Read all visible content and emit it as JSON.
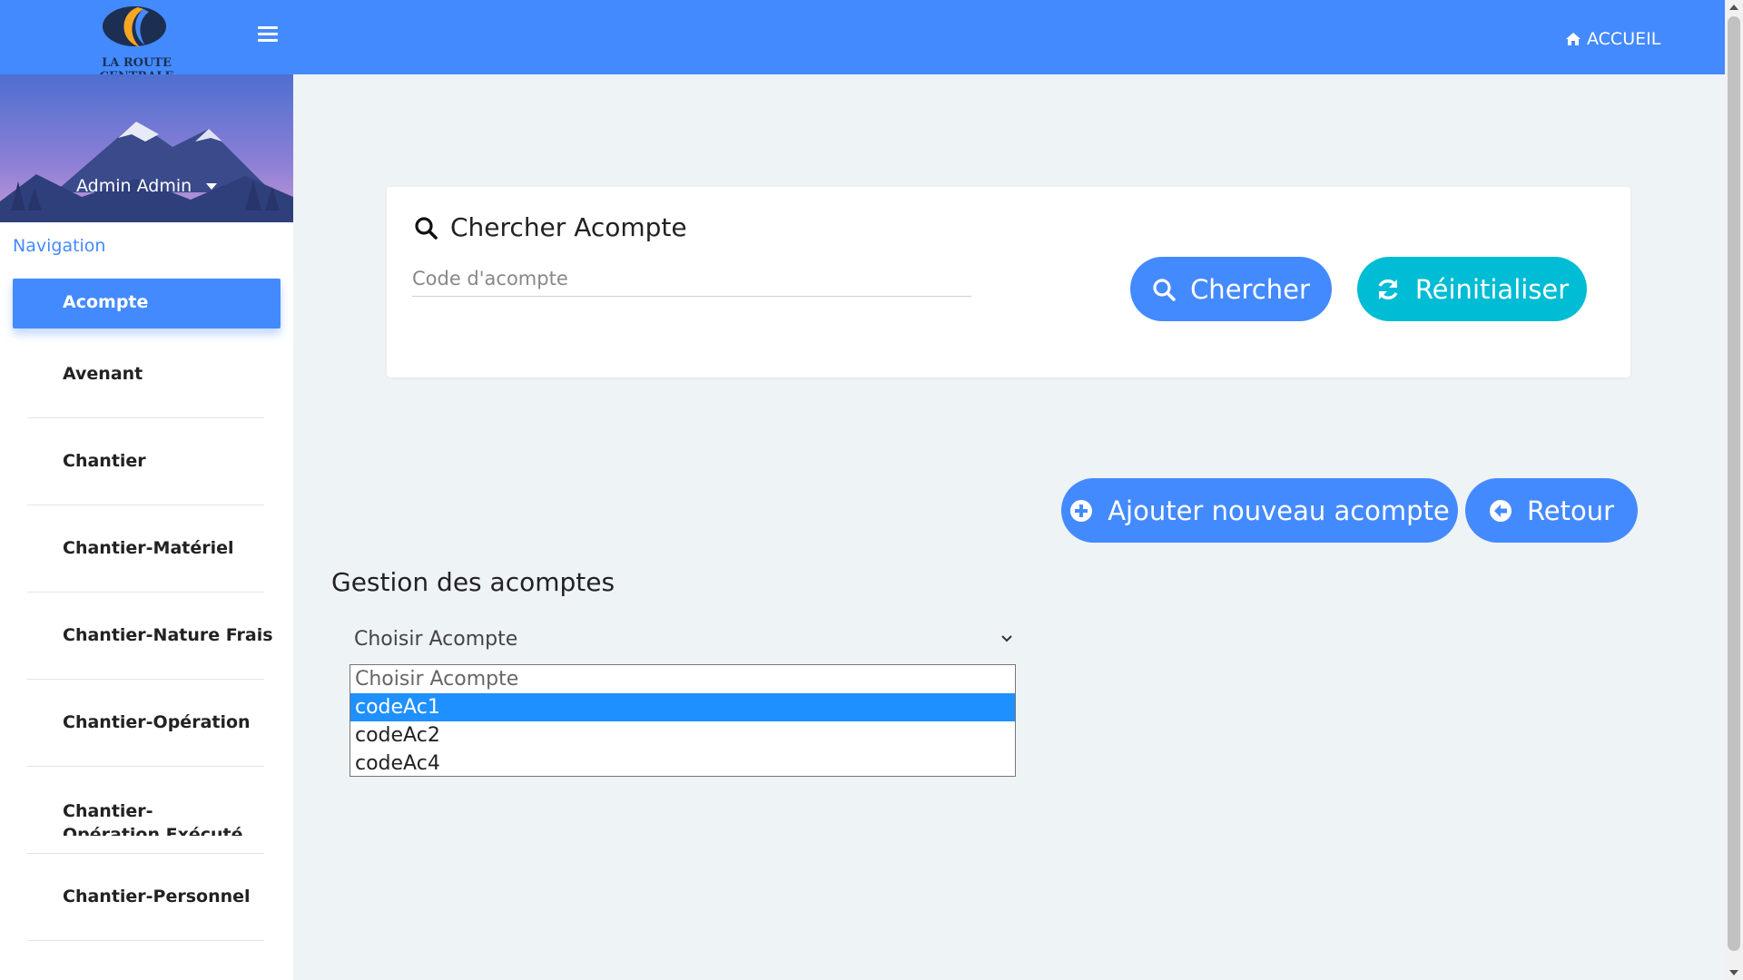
{
  "header": {
    "logo_text": "LA ROUTE CENTRALE",
    "home_link": "ACCUEIL",
    "bar_color": "#448aff"
  },
  "sidebar": {
    "user_name": "Admin Admin",
    "nav_title": "Navigation",
    "items": [
      {
        "label": "Acompte",
        "active": true
      },
      {
        "label": "Avenant"
      },
      {
        "label": "Chantier"
      },
      {
        "label": "Chantier-Matériel"
      },
      {
        "label": "Chantier-Nature Frais"
      },
      {
        "label": "Chantier-Opération"
      },
      {
        "label": "Chantier-Opération Exécuté"
      },
      {
        "label": "Chantier-Personnel"
      }
    ]
  },
  "search": {
    "title": "Chercher Acompte",
    "placeholder": "Code d'acompte",
    "value": "",
    "search_button": "Chercher",
    "reset_button": "Réinitialiser"
  },
  "actions": {
    "add_button": "Ajouter nouveau acompte",
    "back_button": "Retour"
  },
  "management": {
    "title": "Gestion des acomptes",
    "select_value": "Choisir Acompte",
    "options": [
      "Choisir Acompte",
      "codeAc1",
      "codeAc2",
      "codeAc4"
    ],
    "highlighted": "codeAc1"
  },
  "colors": {
    "accent": "#448aff",
    "teal": "#00bcd4",
    "highlight": "#1e90ff"
  }
}
